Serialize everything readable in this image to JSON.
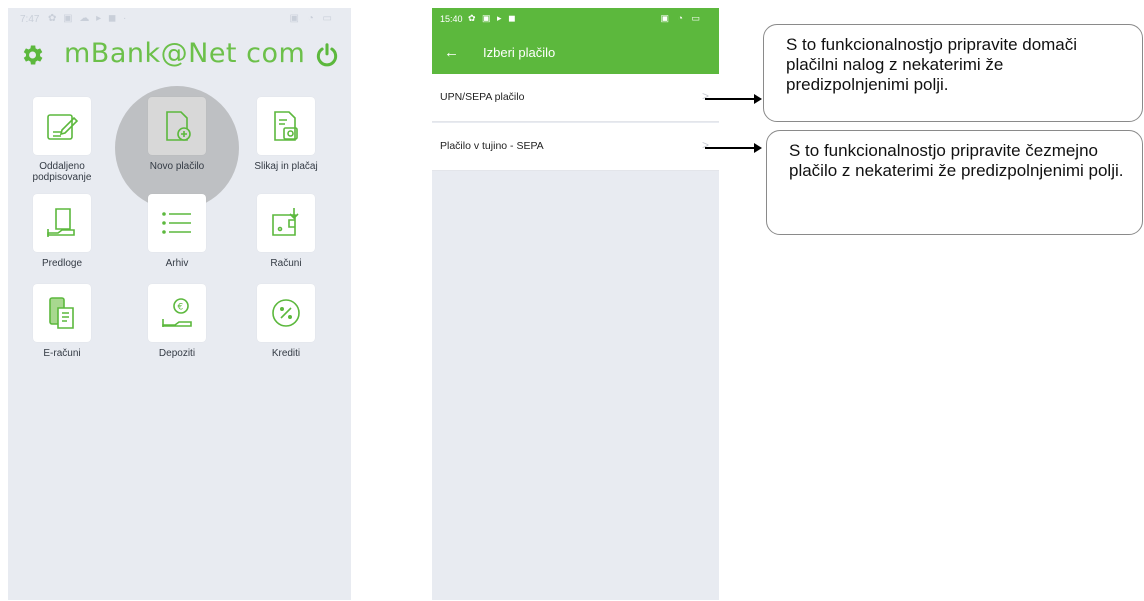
{
  "phone1": {
    "status": {
      "time": "7:47",
      "left_icons": "✿ ▣ ☁ ▸ ◼ ·",
      "right_icons": "▣ ◔ ▭"
    },
    "brand": "mBank@Net com",
    "icons": {
      "settings": "gear-icon",
      "power": "power-icon"
    },
    "tiles": [
      {
        "label": "Oddaljeno podpisovanje",
        "icon": "sign-document-icon"
      },
      {
        "label": "Novo plačilo",
        "icon": "new-payment-icon"
      },
      {
        "label": "Slikaj in plačaj",
        "icon": "scan-pay-icon"
      },
      {
        "label": "Predloge",
        "icon": "templates-icon"
      },
      {
        "label": "Arhiv",
        "icon": "archive-list-icon"
      },
      {
        "label": "Računi",
        "icon": "accounts-wallet-icon"
      },
      {
        "label": "E-računi",
        "icon": "e-invoice-icon"
      },
      {
        "label": "Depoziti",
        "icon": "deposit-icon"
      },
      {
        "label": "Krediti",
        "icon": "credit-percent-icon"
      }
    ],
    "colors": {
      "brand_green": "#6cc04a",
      "background": "#e8ebf1"
    }
  },
  "phone2": {
    "status": {
      "time": "15:40",
      "left_icons": "✿ ▣ ▸ ◼",
      "right_icons": "▣ ◔ ▭"
    },
    "back_icon": "back-arrow-icon",
    "back_glyph": "←",
    "title": "Izberi plačilo",
    "items": [
      {
        "label": "UPN/SEPA plačilo",
        "chevron": ">"
      },
      {
        "label": "Plačilo v tujino - SEPA",
        "chevron": ">"
      }
    ],
    "colors": {
      "header_green": "#5cb83d"
    }
  },
  "callouts": [
    {
      "text": "S to funkcionalnostjo pripravite domači plačilni nalog z nekaterimi že predizpolnjenimi polji."
    },
    {
      "text": "S to funkcionalnostjo pripravite čezmejno plačilo z nekaterimi že predizpolnjenimi polji."
    }
  ]
}
